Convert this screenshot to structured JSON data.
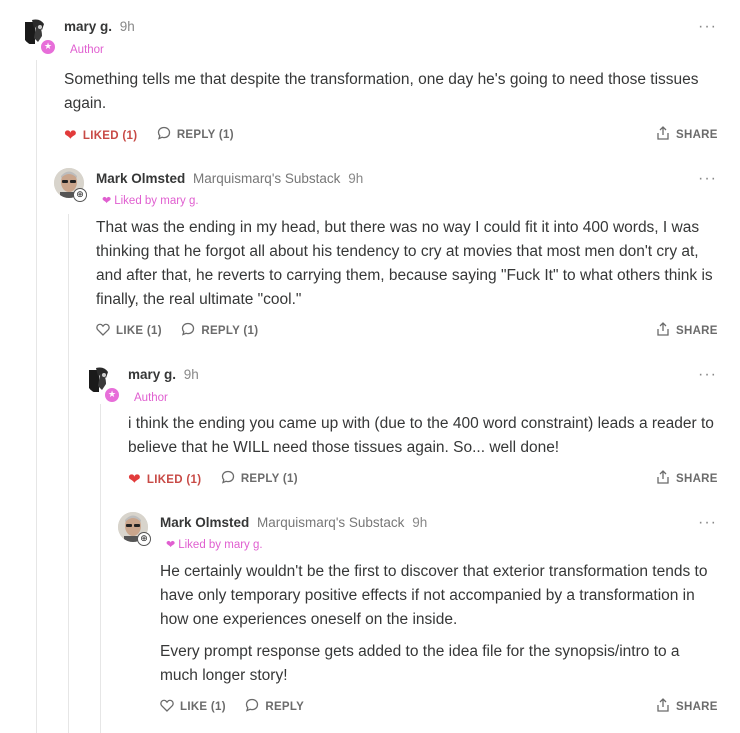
{
  "comments": [
    {
      "author": "mary g.",
      "publication": "",
      "time": "9h",
      "role": "Author",
      "liked_by": "",
      "paragraphs": [
        "Something tells me that despite the transformation, one day he's going to need those tissues again."
      ],
      "like_label": "LIKED (1)",
      "reply_label": "REPLY (1)",
      "share_label": "SHARE"
    },
    {
      "author": "Mark Olmsted",
      "publication": "Marquismarq's Substack",
      "time": "9h",
      "role": "",
      "liked_by": "Liked by mary g.",
      "paragraphs": [
        "That was the ending in my head, but there was no way I could fit it into 400 words, I was thinking that he forgot all about his tendency to cry at movies that most men don't cry at, and after that, he reverts to carrying them, because saying \"Fuck It\" to what others think is finally, the real ultimate \"cool.\""
      ],
      "like_label": "LIKE (1)",
      "reply_label": "REPLY (1)",
      "share_label": "SHARE"
    },
    {
      "author": "mary g.",
      "publication": "",
      "time": "9h",
      "role": "Author",
      "liked_by": "",
      "paragraphs": [
        "i think the ending you came up with (due to the 400 word constraint) leads a reader to believe that he WILL need those tissues again. So... well done!"
      ],
      "like_label": "LIKED (1)",
      "reply_label": "REPLY (1)",
      "share_label": "SHARE"
    },
    {
      "author": "Mark Olmsted",
      "publication": "Marquismarq's Substack",
      "time": "9h",
      "role": "",
      "liked_by": "Liked by mary g.",
      "paragraphs": [
        "He certainly wouldn't be the first to discover that exterior transformation tends to have only temporary positive effects if not accompanied by a transformation in how one experiences oneself on the inside.",
        "Every prompt response gets added to the idea file for the synopsis/intro to a much longer story!"
      ],
      "like_label": "LIKE (1)",
      "reply_label": "REPLY",
      "share_label": "SHARE"
    }
  ],
  "colors": {
    "accent_pink": "#e05fd0",
    "liked_red": "#e23b3b",
    "text": "#363737",
    "muted": "#6b6b6b"
  },
  "icons": [
    "heart-icon",
    "speech-bubble-icon",
    "share-icon",
    "more-icon"
  ]
}
